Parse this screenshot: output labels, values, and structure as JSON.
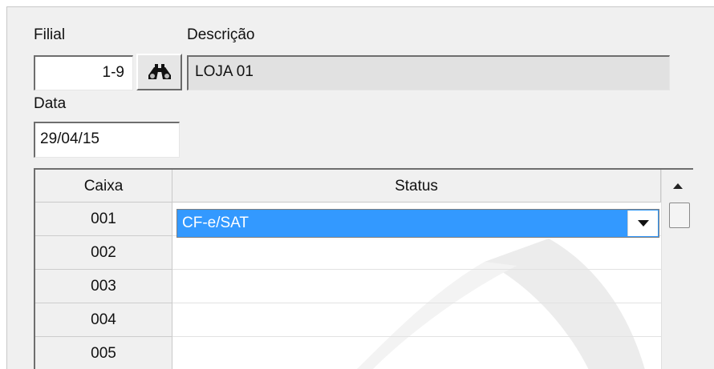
{
  "form": {
    "filial_label": "Filial",
    "filial_value": "1-9",
    "descricao_label": "Descrição",
    "descricao_value": "LOJA 01",
    "data_label": "Data",
    "data_value": "29/04/15"
  },
  "grid": {
    "columns": [
      "Caixa",
      "Status"
    ],
    "rows": [
      {
        "caixa": "001",
        "status": "CF-e/SAT"
      },
      {
        "caixa": "002",
        "status": ""
      },
      {
        "caixa": "003",
        "status": ""
      },
      {
        "caixa": "004",
        "status": ""
      },
      {
        "caixa": "005",
        "status": ""
      }
    ]
  },
  "icons": {
    "lookup": "binoculars-icon",
    "dropdown": "chevron-down-icon",
    "scroll_up": "arrow-up-icon"
  },
  "colors": {
    "selection": "#3399ff",
    "readonly_field": "#e1e1e1",
    "panel": "#f0f0f0"
  }
}
